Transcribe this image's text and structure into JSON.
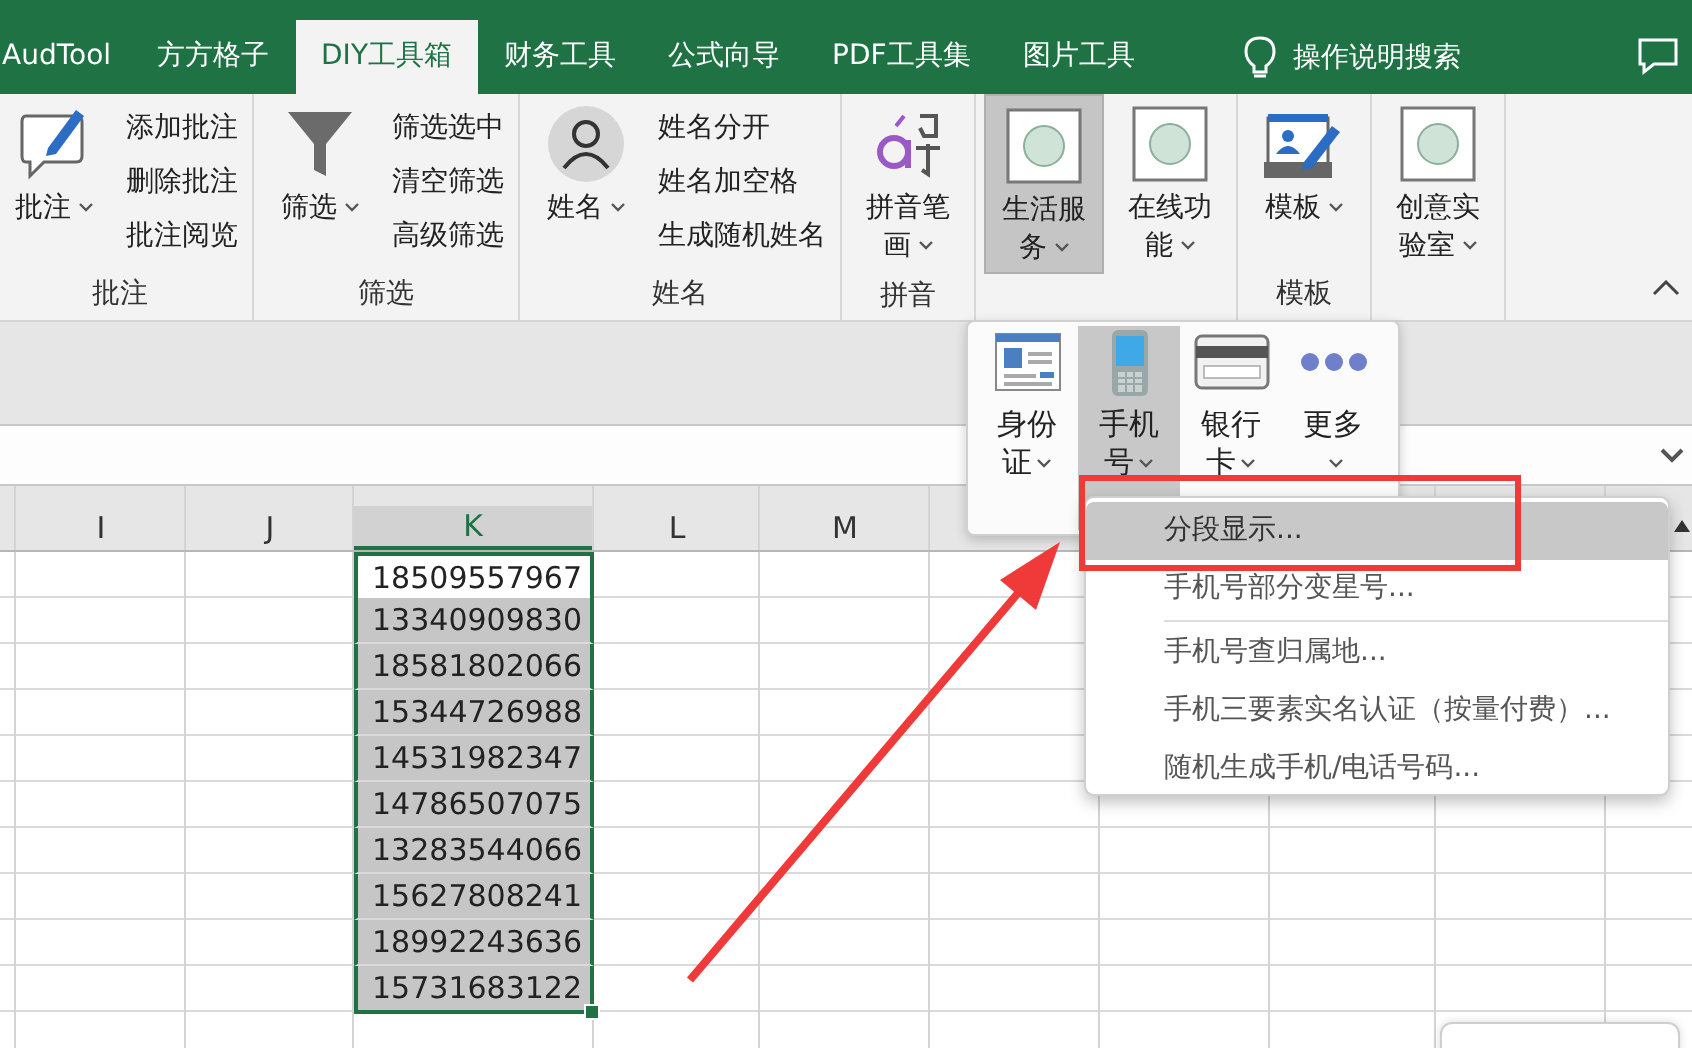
{
  "ribbon_tabs": [
    {
      "label": "AudTool",
      "selected": false
    },
    {
      "label": "方方格子",
      "selected": false
    },
    {
      "label": "DIY工具箱",
      "selected": true
    },
    {
      "label": "财务工具",
      "selected": false
    },
    {
      "label": "公式向导",
      "selected": false
    },
    {
      "label": "PDF工具集",
      "selected": false
    },
    {
      "label": "图片工具",
      "selected": false
    }
  ],
  "search": {
    "label": "操作说明搜索"
  },
  "ribbon_groups": [
    {
      "label": "批注",
      "large": [
        {
          "label": "批注",
          "pressed": false
        }
      ],
      "small": [
        "添加批注",
        "删除批注",
        "批注阅览"
      ]
    },
    {
      "label": "筛选",
      "large": [
        {
          "label": "筛选",
          "pressed": false
        }
      ],
      "small": [
        "筛选选中",
        "清空筛选",
        "高级筛选"
      ]
    },
    {
      "label": "姓名",
      "large": [
        {
          "label": "姓名",
          "pressed": false
        }
      ],
      "small": [
        "姓名分开",
        "姓名加空格",
        "生成随机姓名"
      ]
    },
    {
      "label": "拼音",
      "large": [
        {
          "label": "拼音笔画",
          "pressed": false
        }
      ]
    },
    {
      "large": [
        {
          "label": "生活服务",
          "pressed": true
        },
        {
          "label": "在线功能",
          "pressed": false
        }
      ]
    },
    {
      "label": "模板",
      "large": [
        {
          "label": "模板",
          "pressed": false
        }
      ]
    },
    {
      "large": [
        {
          "label": "创意实验室",
          "pressed": false
        }
      ]
    }
  ],
  "sheet": {
    "columns": [
      "I",
      "J",
      "K",
      "L",
      "M"
    ],
    "rows": [
      {
        "value": "18509557967",
        "active": true
      },
      {
        "value": "13340909830",
        "active": false
      },
      {
        "value": "18581802066",
        "active": false
      },
      {
        "value": "15344726988",
        "active": false
      },
      {
        "value": "14531982347",
        "active": false
      },
      {
        "value": "14786507075",
        "active": false
      },
      {
        "value": "13283544066",
        "active": false
      },
      {
        "value": "15627808241",
        "active": false
      },
      {
        "value": "18992243636",
        "active": false
      },
      {
        "value": "15731683122",
        "active": false
      }
    ]
  },
  "life_service_menu": {
    "items": [
      {
        "label": "身份证",
        "selected": false
      },
      {
        "label": "手机号",
        "selected": true
      },
      {
        "label": "银行卡",
        "selected": false
      },
      {
        "label": "更多",
        "selected": false
      }
    ]
  },
  "phone_menu": {
    "items": [
      {
        "kind": "item",
        "label": "分段显示...",
        "highlighted": true
      },
      {
        "kind": "item",
        "label": "手机号部分变星号...",
        "highlighted": false
      },
      {
        "kind": "separator"
      },
      {
        "kind": "item",
        "label": "手机号查归属地...",
        "highlighted": false
      },
      {
        "kind": "item",
        "label": "手机三要素实名认证（按量付费）...",
        "highlighted": false
      },
      {
        "kind": "item",
        "label": "随机生成手机/电话号码...",
        "highlighted": false
      }
    ]
  }
}
